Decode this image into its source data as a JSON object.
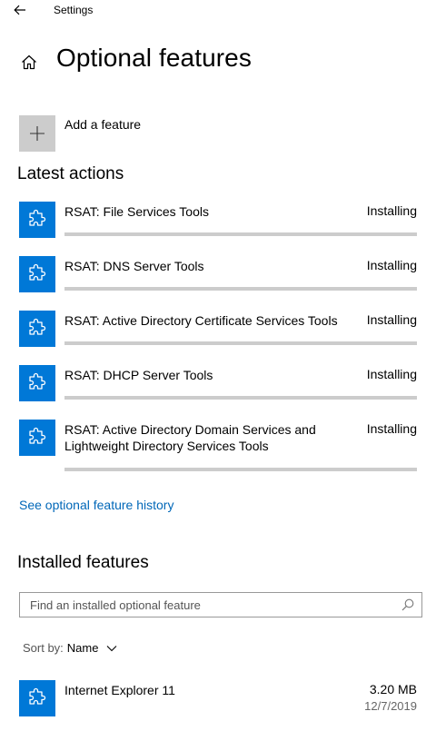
{
  "window": {
    "title": "Settings"
  },
  "page": {
    "title": "Optional features"
  },
  "add_feature": {
    "label": "Add a feature"
  },
  "latest_actions": {
    "heading": "Latest actions",
    "items": [
      {
        "name": "RSAT: File Services Tools",
        "status": "Installing"
      },
      {
        "name": "RSAT: DNS Server Tools",
        "status": "Installing"
      },
      {
        "name": "RSAT: Active Directory Certificate Services Tools",
        "status": "Installing"
      },
      {
        "name": "RSAT: DHCP Server Tools",
        "status": "Installing"
      },
      {
        "name": "RSAT: Active Directory Domain Services and Lightweight Directory Services Tools",
        "status": "Installing"
      }
    ]
  },
  "history_link": {
    "label": "See optional feature history"
  },
  "installed": {
    "heading": "Installed features",
    "search": {
      "placeholder": "Find an installed optional feature"
    },
    "sort": {
      "label": "Sort by:",
      "value": "Name"
    },
    "items": [
      {
        "name": "Internet Explorer 11",
        "size": "3.20 MB",
        "date": "12/7/2019"
      }
    ]
  },
  "colors": {
    "accent": "#0078d7",
    "link": "#0067b8",
    "track": "#cccccc"
  },
  "icons": {
    "back": "back-arrow-icon",
    "home": "home-icon",
    "add": "plus-icon",
    "feature": "puzzle-icon",
    "search": "search-icon",
    "sort": "chevron-down-icon"
  }
}
